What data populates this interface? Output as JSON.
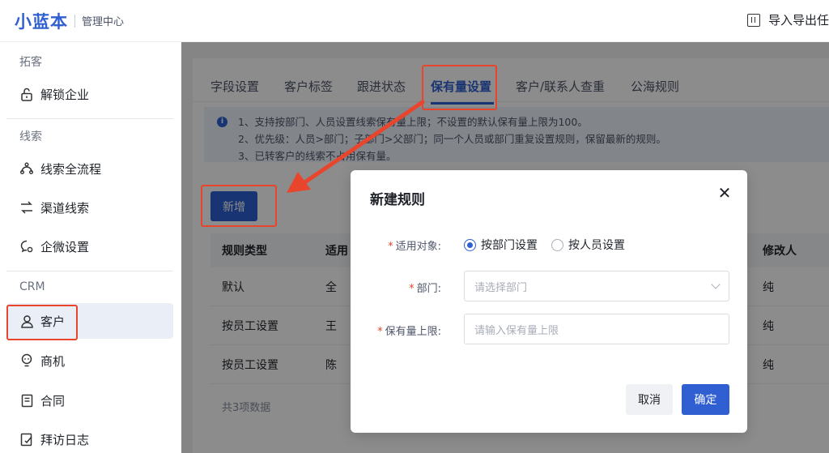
{
  "header": {
    "logo": "小蓝本",
    "subtitle": "管理中心",
    "import_export_label": "导入导出任"
  },
  "sidebar": {
    "sections": [
      {
        "title": "拓客",
        "items": [
          {
            "label": "解锁企业",
            "icon": "unlock-icon"
          }
        ]
      },
      {
        "title": "线索",
        "items": [
          {
            "label": "线索全流程",
            "icon": "funnel-icon"
          },
          {
            "label": "渠道线索",
            "icon": "channel-icon"
          },
          {
            "label": "企微设置",
            "icon": "wecom-icon"
          }
        ]
      },
      {
        "title": "CRM",
        "items": [
          {
            "label": "客户",
            "icon": "user-icon",
            "active": true
          },
          {
            "label": "商机",
            "icon": "bulb-icon"
          },
          {
            "label": "合同",
            "icon": "contract-icon"
          },
          {
            "label": "拜访日志",
            "icon": "log-icon"
          }
        ]
      }
    ]
  },
  "tabs": [
    {
      "label": "字段设置"
    },
    {
      "label": "客户标签"
    },
    {
      "label": "跟进状态"
    },
    {
      "label": "保有量设置",
      "active": true
    },
    {
      "label": "客户/联系人查重"
    },
    {
      "label": "公海规则"
    }
  ],
  "notice": {
    "lines": [
      "1、支持按部门、人员设置线索保有量上限；不设置的默认保有量上限为100。",
      "2、优先级：人员>部门；子部门>父部门；同一个人员或部门重复设置规则，保留最新的规则。",
      "3、已转客户的线索不占用保有量。"
    ]
  },
  "new_button": "新增",
  "table": {
    "headers": [
      "规则类型",
      "适用",
      "修改人"
    ],
    "rows": [
      [
        "默认",
        "全",
        "纯"
      ],
      [
        "按员工设置",
        "王",
        "纯"
      ],
      [
        "按员工设置",
        "陈",
        "纯"
      ]
    ],
    "total": "共3项数据"
  },
  "dialog": {
    "title": "新建规则",
    "target_label": "适用对象:",
    "radio_dept": "按部门设置",
    "radio_person": "按人员设置",
    "dept_label": "部门:",
    "dept_placeholder": "请选择部门",
    "limit_label": "保有量上限:",
    "limit_placeholder": "请输入保有量上限",
    "cancel": "取消",
    "confirm": "确定"
  },
  "colors": {
    "accent": "#2f5fd0",
    "annotation": "#e8452c"
  }
}
